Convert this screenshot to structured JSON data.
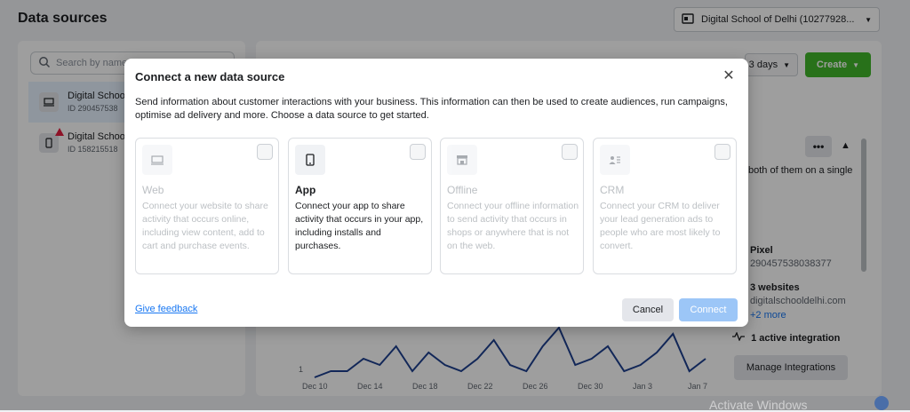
{
  "header": {
    "title": "Data sources",
    "account_label": "Digital School of Delhi (10277928...",
    "account_icon": "business-account-icon"
  },
  "sidebar": {
    "search_placeholder": "Search by name",
    "items": [
      {
        "name": "Digital Schoo",
        "id": "ID 290457538",
        "icon": "desktop-icon",
        "selected": true
      },
      {
        "name": "Digital Schoo",
        "id": "ID 158215518",
        "icon": "mobile-icon",
        "warning": true
      }
    ]
  },
  "toolbar": {
    "days_label": "3 days",
    "create_label": "Create"
  },
  "side_panel": {
    "overflow_text": "both of them on a single",
    "pixel_label": "Pixel",
    "pixel_id": "290457538038377",
    "websites_label": "3 websites",
    "website": "digitalschooldelhi.com",
    "more_link": "+2 more",
    "integration_label": "1 active integration",
    "manage_label": "Manage Integrations"
  },
  "chart": {
    "y_tick": "1",
    "x_ticks": [
      "Dec 10",
      "Dec 14",
      "Dec 18",
      "Dec 22",
      "Dec 26",
      "Dec 30",
      "Jan 3",
      "Jan 7"
    ]
  },
  "chart_data": {
    "type": "line",
    "categories": [
      "Dec 10",
      "Dec 14",
      "Dec 18",
      "Dec 22",
      "Dec 26",
      "Dec 30",
      "Jan 3",
      "Jan 7"
    ],
    "series": [
      {
        "values": [
          1,
          2,
          2,
          4,
          3,
          6,
          2,
          5,
          3,
          2,
          4,
          7,
          3,
          2,
          6,
          9,
          3,
          4,
          6,
          2,
          3,
          5,
          8,
          2,
          4
        ]
      }
    ],
    "ylim": [
      0,
      10
    ]
  },
  "watermark": "Activate Windows",
  "modal": {
    "title": "Connect a new data source",
    "description": "Send information about customer interactions with your business. This information can then be used to create audiences, run campaigns, optimise ad delivery and more. Choose a data source to get started.",
    "cards": [
      {
        "title": "Web",
        "description": "Connect your website to share activity that occurs online, including view content, add to cart and purchase events.",
        "icon": "desktop-icon",
        "enabled": false
      },
      {
        "title": "App",
        "description": "Connect your app to share activity that occurs in your app, including installs and purchases.",
        "icon": "mobile-icon",
        "enabled": true
      },
      {
        "title": "Offline",
        "description": "Connect your offline information to send activity that occurs in shops or anywhere that is not on the web.",
        "icon": "store-icon",
        "enabled": false
      },
      {
        "title": "CRM",
        "description": "Connect your CRM to deliver your lead generation ads to people who are most likely to convert.",
        "icon": "contacts-icon",
        "enabled": false
      }
    ],
    "feedback_label": "Give feedback",
    "cancel_label": "Cancel",
    "connect_label": "Connect"
  }
}
